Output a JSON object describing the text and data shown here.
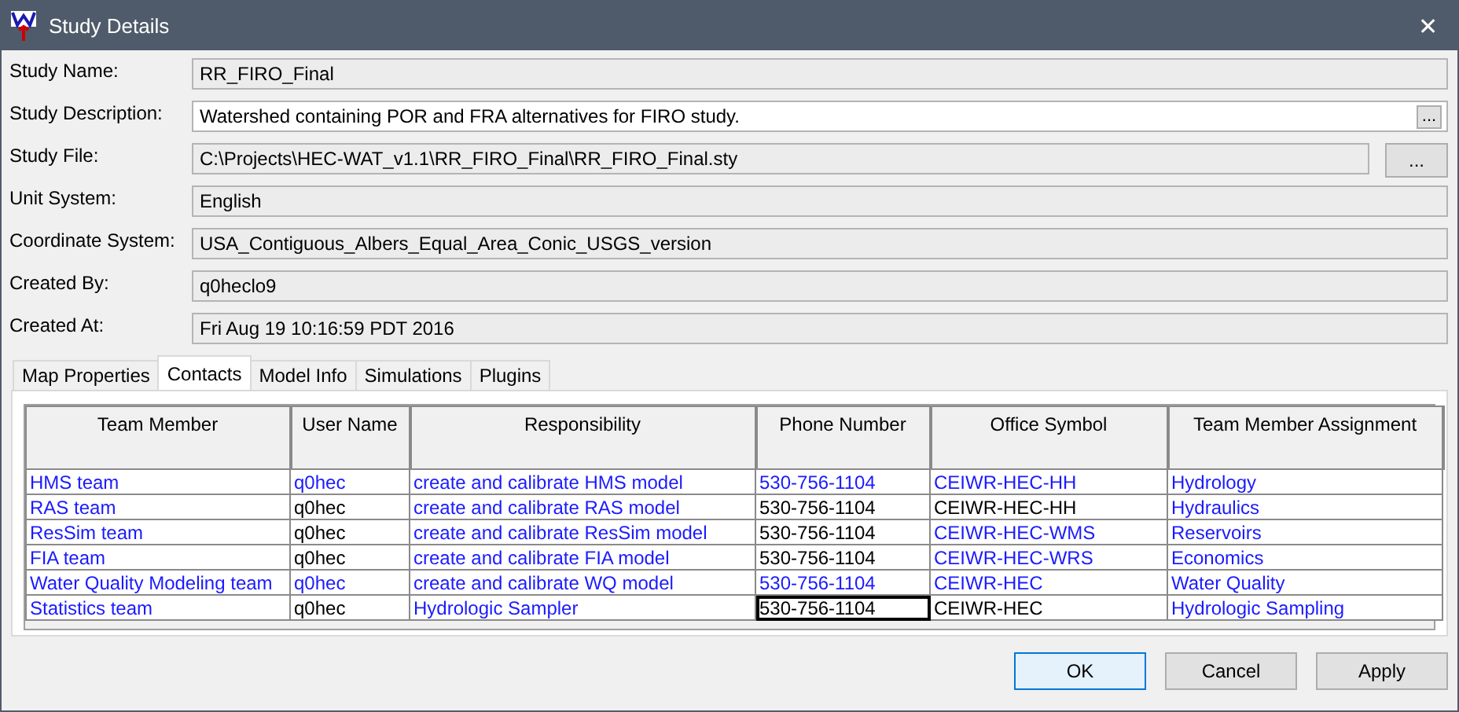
{
  "window": {
    "title": "Study Details",
    "close": "✕"
  },
  "fields": [
    {
      "label": "Study Name:",
      "value": "RR_FIRO_Final",
      "kind": "plain"
    },
    {
      "label": "Study Description:",
      "value": "Watershed containing POR and FRA alternatives for FIRO study.",
      "kind": "inner-browse",
      "browse": "...",
      "editable": true
    },
    {
      "label": "Study File:",
      "value": "C:\\Projects\\HEC-WAT_v1.1\\RR_FIRO_Final\\RR_FIRO_Final.sty",
      "kind": "outer-browse",
      "browse": "..."
    },
    {
      "label": "Unit System:",
      "value": "English",
      "kind": "plain"
    },
    {
      "label": "Coordinate System:",
      "value": "USA_Contiguous_Albers_Equal_Area_Conic_USGS_version",
      "kind": "plain"
    },
    {
      "label": "Created By:",
      "value": "q0heclo9",
      "kind": "plain"
    },
    {
      "label": "Created At:",
      "value": "Fri Aug 19 10:16:59 PDT 2016",
      "kind": "plain"
    }
  ],
  "tabs": [
    {
      "label": "Map Properties",
      "selected": false
    },
    {
      "label": "Contacts",
      "selected": true
    },
    {
      "label": "Model Info",
      "selected": false
    },
    {
      "label": "Simulations",
      "selected": false
    },
    {
      "label": "Plugins",
      "selected": false
    }
  ],
  "table": {
    "columns": [
      "Team Member",
      "User Name",
      "Responsibility",
      "Phone Number",
      "Office Symbol",
      "Team Member Assignment"
    ],
    "rows": [
      [
        {
          "text": "HMS team",
          "link": true
        },
        {
          "text": "q0hec",
          "link": true
        },
        {
          "text": "create and calibrate HMS model",
          "link": true
        },
        {
          "text": "530-756-1104",
          "link": true
        },
        {
          "text": "CEIWR-HEC-HH",
          "link": true
        },
        {
          "text": "Hydrology",
          "link": true
        }
      ],
      [
        {
          "text": "RAS team",
          "link": true
        },
        {
          "text": "q0hec",
          "link": false
        },
        {
          "text": "create and calibrate RAS model",
          "link": true
        },
        {
          "text": "530-756-1104",
          "link": false
        },
        {
          "text": "CEIWR-HEC-HH",
          "link": false
        },
        {
          "text": "Hydraulics",
          "link": true
        }
      ],
      [
        {
          "text": "ResSim team",
          "link": true
        },
        {
          "text": "q0hec",
          "link": false
        },
        {
          "text": "create and calibrate ResSim model",
          "link": true
        },
        {
          "text": "530-756-1104",
          "link": false
        },
        {
          "text": "CEIWR-HEC-WMS",
          "link": true
        },
        {
          "text": "Reservoirs",
          "link": true
        }
      ],
      [
        {
          "text": "FIA team",
          "link": true
        },
        {
          "text": "q0hec",
          "link": false
        },
        {
          "text": "create and calibrate FIA model",
          "link": true
        },
        {
          "text": "530-756-1104",
          "link": false
        },
        {
          "text": "CEIWR-HEC-WRS",
          "link": true
        },
        {
          "text": "Economics",
          "link": true
        }
      ],
      [
        {
          "text": "Water Quality Modeling team",
          "link": true
        },
        {
          "text": "q0hec",
          "link": true
        },
        {
          "text": "create and calibrate WQ model",
          "link": true
        },
        {
          "text": "530-756-1104",
          "link": true
        },
        {
          "text": "CEIWR-HEC",
          "link": true
        },
        {
          "text": "Water Quality",
          "link": true
        }
      ],
      [
        {
          "text": "Statistics team",
          "link": true
        },
        {
          "text": "q0hec",
          "link": false
        },
        {
          "text": "Hydrologic Sampler",
          "link": true
        },
        {
          "text": "530-756-1104",
          "link": false,
          "focused": true
        },
        {
          "text": "CEIWR-HEC",
          "link": false
        },
        {
          "text": "Hydrologic Sampling",
          "link": true
        }
      ]
    ]
  },
  "buttons": [
    {
      "label": "OK",
      "default": true
    },
    {
      "label": "Cancel",
      "default": false
    },
    {
      "label": "Apply",
      "default": false
    }
  ]
}
